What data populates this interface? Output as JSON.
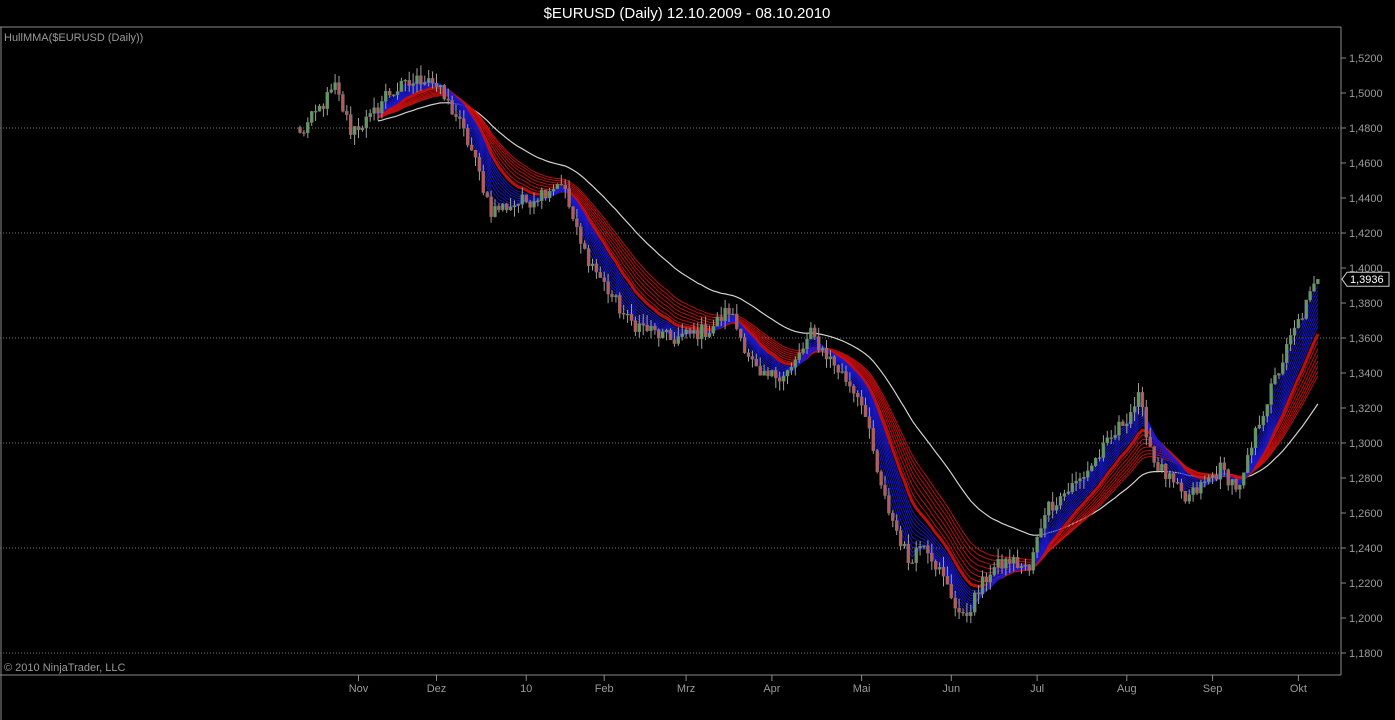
{
  "chart_data": {
    "type": "candlestick",
    "title": "$EURUSD (Daily)  12.10.2009 - 08.10.2010",
    "indicator_label": "HullMMA($EURUSD (Daily))",
    "copyright": "© 2010 NinjaTrader, LLC",
    "last_price_label": "1,3936",
    "last_price": 1.3936,
    "ylim": [
      1.17,
      1.535
    ],
    "y_ticks": [
      1.52,
      1.5,
      1.48,
      1.46,
      1.44,
      1.42,
      1.4,
      1.38,
      1.36,
      1.34,
      1.32,
      1.3,
      1.28,
      1.26,
      1.24,
      1.22,
      1.2,
      1.18
    ],
    "y_tick_labels": [
      "1,5200",
      "1,5000",
      "1,4800",
      "1,4600",
      "1,4400",
      "1,4200",
      "1,4000",
      "1,3800",
      "1,3600",
      "1,3400",
      "1,3200",
      "1,3000",
      "1,2800",
      "1,2600",
      "1,2400",
      "1,2200",
      "1,2000",
      "1,1800"
    ],
    "gridlines": [
      1.48,
      1.42,
      1.36,
      1.3,
      1.24,
      1.18
    ],
    "bar_count": 262,
    "x_ticks": [
      {
        "label": "Nov",
        "bar": 15
      },
      {
        "label": "Dez",
        "bar": 35
      },
      {
        "label": "10",
        "bar": 58
      },
      {
        "label": "Feb",
        "bar": 78
      },
      {
        "label": "Mrz",
        "bar": 99
      },
      {
        "label": "Apr",
        "bar": 121
      },
      {
        "label": "Mai",
        "bar": 144
      },
      {
        "label": "Jun",
        "bar": 167
      },
      {
        "label": "Jul",
        "bar": 189
      },
      {
        "label": "Aug",
        "bar": 212
      },
      {
        "label": "Sep",
        "bar": 234
      },
      {
        "label": "Okt",
        "bar": 256
      }
    ],
    "close_anchors": [
      [
        0,
        1.476
      ],
      [
        9,
        1.503
      ],
      [
        13,
        1.479
      ],
      [
        18,
        1.485
      ],
      [
        22,
        1.499
      ],
      [
        33,
        1.51
      ],
      [
        40,
        1.487
      ],
      [
        44,
        1.467
      ],
      [
        49,
        1.433
      ],
      [
        59,
        1.439
      ],
      [
        67,
        1.45
      ],
      [
        72,
        1.413
      ],
      [
        79,
        1.387
      ],
      [
        84,
        1.37
      ],
      [
        95,
        1.359
      ],
      [
        105,
        1.365
      ],
      [
        110,
        1.376
      ],
      [
        118,
        1.336
      ],
      [
        126,
        1.342
      ],
      [
        131,
        1.362
      ],
      [
        138,
        1.342
      ],
      [
        144,
        1.325
      ],
      [
        149,
        1.273
      ],
      [
        156,
        1.233
      ],
      [
        160,
        1.245
      ],
      [
        165,
        1.222
      ],
      [
        170,
        1.199
      ],
      [
        177,
        1.227
      ],
      [
        182,
        1.233
      ],
      [
        187,
        1.227
      ],
      [
        191,
        1.262
      ],
      [
        200,
        1.279
      ],
      [
        208,
        1.302
      ],
      [
        215,
        1.325
      ],
      [
        219,
        1.29
      ],
      [
        227,
        1.267
      ],
      [
        236,
        1.285
      ],
      [
        241,
        1.273
      ],
      [
        246,
        1.313
      ],
      [
        254,
        1.359
      ],
      [
        261,
        1.3936
      ]
    ],
    "ribbons": {
      "fast_periods": [
        3,
        4,
        5,
        6,
        7,
        8,
        9,
        10,
        11,
        12
      ],
      "slow_periods": [
        14,
        16,
        18,
        20,
        22,
        24,
        26,
        28
      ],
      "baseline_period": 45
    },
    "colors": {
      "background": "#000000",
      "up_candle": "#5f9a5f",
      "down_candle": "#b65a5a",
      "wick": "#a0a0a0",
      "fast_ribbon": "#1a1ad8",
      "slow_ribbon": "#d01010",
      "baseline": "#e8e8e8",
      "axis": "#8a8a8a"
    }
  }
}
